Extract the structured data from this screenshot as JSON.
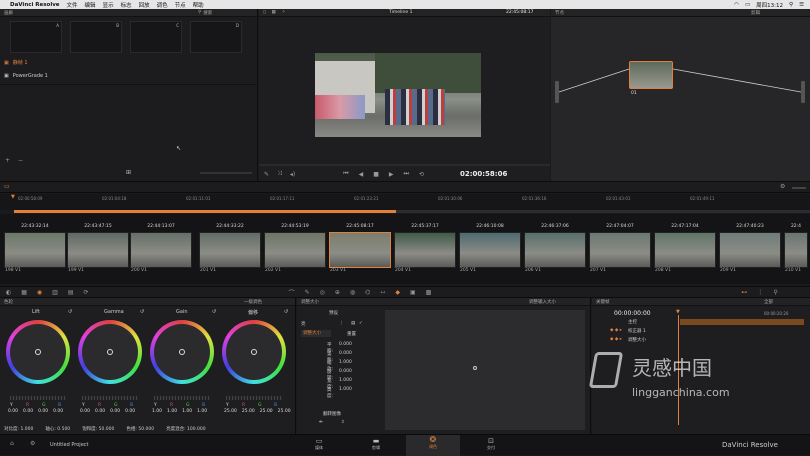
{
  "menubar": {
    "app": "DaVinci Resolve",
    "items": [
      "文件",
      "编辑",
      "显示",
      "标志",
      "回放",
      "调色",
      "节点",
      "帮助"
    ],
    "clock": "周四13:12"
  },
  "gallery": {
    "title": "画廊",
    "search": "搜索",
    "slots": [
      "A",
      "B",
      "C",
      "D"
    ],
    "stills": "静帧 1",
    "powergrade": "PowerGrade 1",
    "plus": "+",
    "minus": "−"
  },
  "viewer": {
    "title": "Timeline 1",
    "timecode": "22:45:08:17",
    "playhead": "02:00:58:06"
  },
  "nodes": {
    "title": "节点",
    "clip_label": "剪辑",
    "node_id": "01"
  },
  "timeline": {
    "ruler": [
      "02:00:58:09",
      "02:01:04:18",
      "02:01:11:01",
      "02:01:17:11",
      "02:01:23:21",
      "02:01:30:06",
      "02:01:36:16",
      "02:01:43:01",
      "02:01:49:11"
    ],
    "clips": [
      {
        "tc": "22:43:32:14",
        "label": "198  V1",
        "color": "#6a7868"
      },
      {
        "tc": "22:43:47:15",
        "label": "199  V1",
        "color": "#5f6a62"
      },
      {
        "tc": "22:44:13:07",
        "label": "200  V1",
        "color": "#667068"
      },
      {
        "tc": "22:44:33:22",
        "label": "201  V1",
        "color": "#626c66"
      },
      {
        "tc": "22:44:53:19",
        "label": "202  V1",
        "color": "#6d7565"
      },
      {
        "tc": "22:45:08:17",
        "label": "203  V1",
        "color": "#7a7e6d"
      },
      {
        "tc": "22:45:37:17",
        "label": "204  V1",
        "color": "#3f5a48"
      },
      {
        "tc": "22:46:10:08",
        "label": "205  V1",
        "color": "#4e6a70"
      },
      {
        "tc": "22:46:37:06",
        "label": "206  V1",
        "color": "#576e6a"
      },
      {
        "tc": "22:47:04:07",
        "label": "207  V1",
        "color": "#6a7870"
      },
      {
        "tc": "22:47:17:04",
        "label": "208  V1",
        "color": "#5f7468"
      },
      {
        "tc": "22:47:40:23",
        "label": "209  V1",
        "color": "#6e7c78"
      },
      {
        "tc": "22:4",
        "label": "210  V1",
        "color": "#6a7470"
      }
    ]
  },
  "color": {
    "title": "色轮",
    "mode": "一级调色",
    "wheels": [
      {
        "name": "Lift",
        "vals": [
          "0.00",
          "0.00",
          "0.00",
          "0.00"
        ]
      },
      {
        "name": "Gamma",
        "vals": [
          "0.00",
          "0.00",
          "0.00",
          "0.00"
        ]
      },
      {
        "name": "Gain",
        "vals": [
          "1.00",
          "1.00",
          "1.00",
          "1.00"
        ]
      },
      {
        "name": "偏移",
        "vals": [
          "25.00",
          "25.00",
          "25.00",
          "25.00"
        ]
      }
    ],
    "channel_labels": [
      "Y",
      "R",
      "G",
      "B"
    ],
    "footer": [
      "对比度: 1.000",
      "轴心: 0.500",
      "饱和度: 50.000",
      "色相: 50.000",
      "亮度混合: 100.000"
    ]
  },
  "resize": {
    "title": "调整大小",
    "title2": "调整输入大小",
    "preset": "预设",
    "section": "调整大小",
    "mode_value": "亮",
    "reset": "重置",
    "params": [
      {
        "name": "平移:",
        "value": "0.000"
      },
      {
        "name": "竖移:",
        "value": "0.000"
      },
      {
        "name": "缩放:",
        "value": "1.000"
      },
      {
        "name": "旋转:",
        "value": "0.000"
      },
      {
        "name": "宽度:",
        "value": "1.000"
      },
      {
        "name": "高度:",
        "value": "1.000"
      }
    ],
    "flip": "翻转图像"
  },
  "keyframes": {
    "title": "关键帧",
    "scope": "全部",
    "timecode": "00:00:00:00",
    "end_tc": "00:00:20:20",
    "rows": [
      "主控",
      "校正器 1",
      "调整大小"
    ]
  },
  "bottombar": {
    "project": "Untitled Project",
    "tabs": [
      "媒体",
      "剪辑",
      "调色",
      "交付"
    ],
    "brand": "DaVinci Resolve"
  },
  "watermark": {
    "cn": "灵感中国",
    "url": "lingganchina.com"
  }
}
